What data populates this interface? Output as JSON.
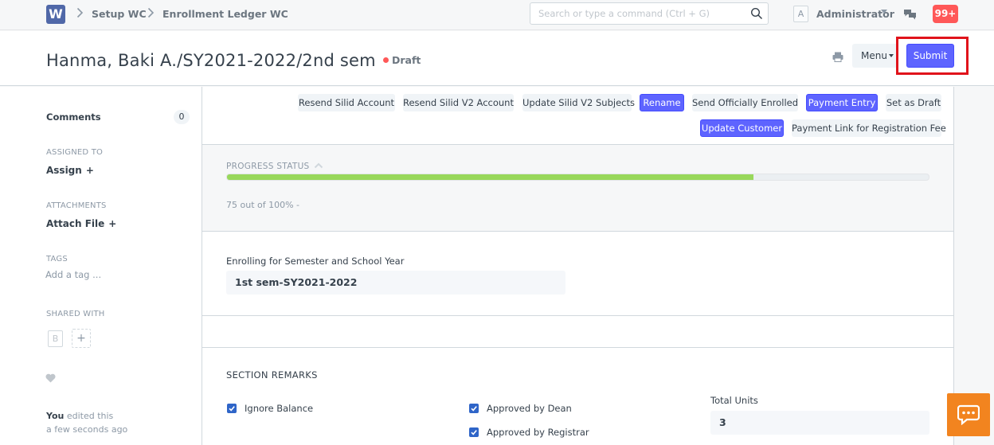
{
  "navbar": {
    "logo": "W",
    "breadcrumbs": [
      "Setup WC",
      "Enrollment Ledger WC"
    ],
    "search_placeholder": "Search or type a command (Ctrl + G)",
    "user_initial": "A",
    "user_name": "Administrator",
    "notifications": "99+"
  },
  "page_head": {
    "title": "Hanma, Baki A./SY2021-2022/2nd sem",
    "status": "Draft",
    "menu_label": "Menu",
    "submit_label": "Submit",
    "status_color": "#ff5858",
    "primary_color": "#5e64ff"
  },
  "sidebar": {
    "comments_label": "Comments",
    "comments_count": "0",
    "assigned_to_label": "ASSIGNED TO",
    "assign_label": "Assign",
    "attachments_label": "ATTACHMENTS",
    "attach_label": "Attach File",
    "tags_label": "TAGS",
    "add_tag_label": "Add a tag ...",
    "shared_with_label": "SHARED WITH",
    "shared_initial": "B",
    "edited_by": "You",
    "edited_text": "edited this",
    "edited_time": "a few seconds ago"
  },
  "actions": [
    {
      "label": "Resend Silid Account",
      "primary": false
    },
    {
      "label": "Resend Silid V2 Account",
      "primary": false
    },
    {
      "label": "Update Silid V2 Subjects",
      "primary": false
    },
    {
      "label": "Rename",
      "primary": true
    },
    {
      "label": "Send Officially Enrolled",
      "primary": false
    },
    {
      "label": "Payment Entry",
      "primary": true
    },
    {
      "label": "Set as Draft",
      "primary": false
    },
    {
      "label": "Update Customer",
      "primary": true
    },
    {
      "label": "Payment Link for Registration Fee",
      "primary": false
    }
  ],
  "progress": {
    "heading": "PROGRESS STATUS",
    "percent": 75,
    "text": "75 out of 100% -",
    "bar_color": "#98d85b"
  },
  "enrollment": {
    "label": "Enrolling for Semester and School Year",
    "value": "1st sem-SY2021-2022"
  },
  "remarks": {
    "heading": "SECTION REMARKS",
    "ignore_balance": "Ignore Balance",
    "approved_by_dean": "Approved by Dean",
    "approved_by_registrar": "Approved by Registrar",
    "total_units_label": "Total Units",
    "total_units_value": "3"
  }
}
